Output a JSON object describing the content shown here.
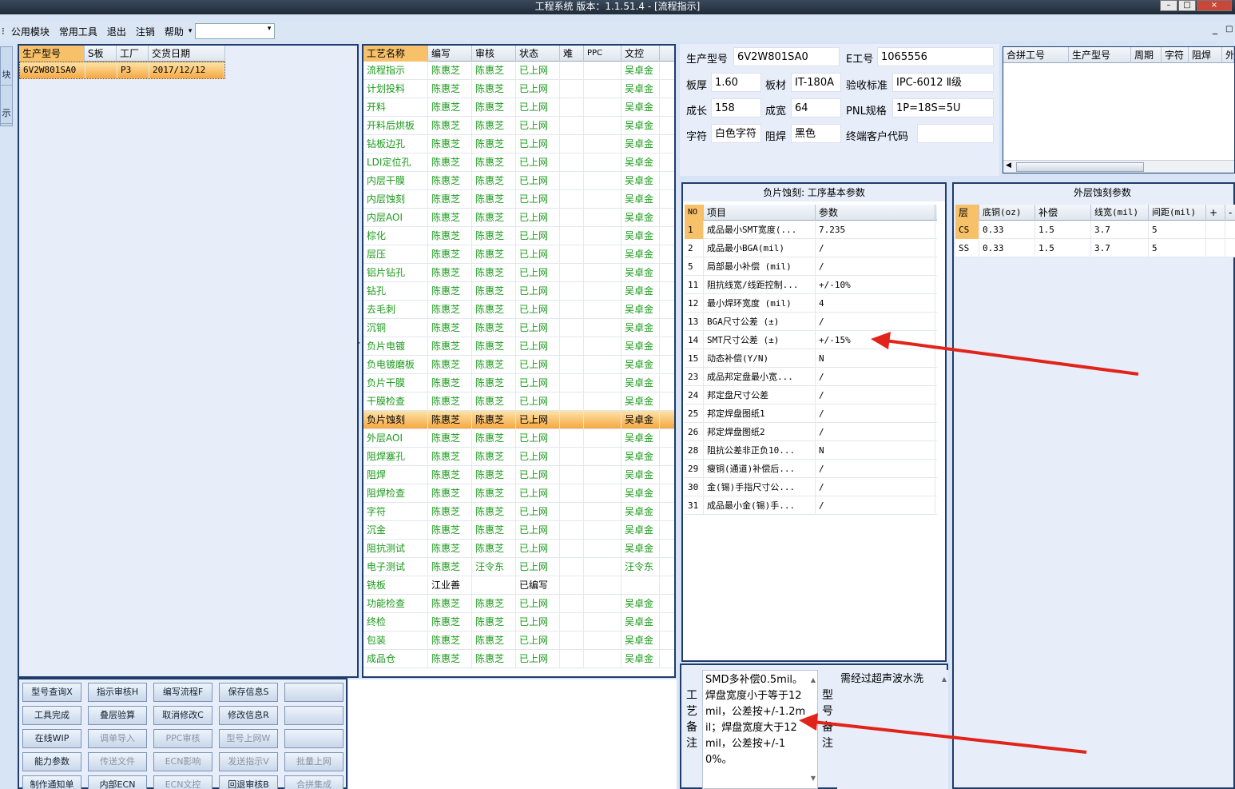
{
  "app": {
    "title": "工程系统  版本：1.1.51.4 - [流程指示]",
    "win_min": "–",
    "win_max": "□",
    "win_close": "×"
  },
  "menu": {
    "items": [
      "公用模块",
      "常用工具",
      "退出",
      "注销",
      "帮助"
    ],
    "helper_arrow": "▾",
    "combo_value": "",
    "left_glyph": "⁝",
    "right_icons": [
      "_",
      "□"
    ]
  },
  "leftstrip": {
    "tabs": [
      "块",
      "示"
    ]
  },
  "orders": {
    "columns": [
      "生产型号",
      "S板",
      "工厂",
      "交货日期"
    ],
    "rows": [
      {
        "model": "6V2W801SA0",
        "s": "",
        "factory": "P3",
        "date": "2017/12/12"
      }
    ]
  },
  "process": {
    "columns": [
      "工艺名称",
      "编写",
      "审核",
      "状态",
      "难",
      "PPC",
      "文控"
    ],
    "rows": [
      [
        "流程指示",
        "陈惠芝",
        "陈惠芝",
        "已上网",
        "",
        "",
        "吴卓金"
      ],
      [
        "计划投料",
        "陈惠芝",
        "陈惠芝",
        "已上网",
        "",
        "",
        "吴卓金"
      ],
      [
        "开料",
        "陈惠芝",
        "陈惠芝",
        "已上网",
        "",
        "",
        "吴卓金"
      ],
      [
        "开料后烘板",
        "陈惠芝",
        "陈惠芝",
        "已上网",
        "",
        "",
        "吴卓金"
      ],
      [
        "钻板边孔",
        "陈惠芝",
        "陈惠芝",
        "已上网",
        "",
        "",
        "吴卓金"
      ],
      [
        "LDI定位孔",
        "陈惠芝",
        "陈惠芝",
        "已上网",
        "",
        "",
        "吴卓金"
      ],
      [
        "内层干膜",
        "陈惠芝",
        "陈惠芝",
        "已上网",
        "",
        "",
        "吴卓金"
      ],
      [
        "内层蚀刻",
        "陈惠芝",
        "陈惠芝",
        "已上网",
        "",
        "",
        "吴卓金"
      ],
      [
        "内层AOI",
        "陈惠芝",
        "陈惠芝",
        "已上网",
        "",
        "",
        "吴卓金"
      ],
      [
        "棕化",
        "陈惠芝",
        "陈惠芝",
        "已上网",
        "",
        "",
        "吴卓金"
      ],
      [
        "层压",
        "陈惠芝",
        "陈惠芝",
        "已上网",
        "",
        "",
        "吴卓金"
      ],
      [
        "铝片钻孔",
        "陈惠芝",
        "陈惠芝",
        "已上网",
        "",
        "",
        "吴卓金"
      ],
      [
        "钻孔",
        "陈惠芝",
        "陈惠芝",
        "已上网",
        "",
        "",
        "吴卓金"
      ],
      [
        "去毛刺",
        "陈惠芝",
        "陈惠芝",
        "已上网",
        "",
        "",
        "吴卓金"
      ],
      [
        "沉铜",
        "陈惠芝",
        "陈惠芝",
        "已上网",
        "",
        "",
        "吴卓金"
      ],
      [
        "负片电镀",
        "陈惠芝",
        "陈惠芝",
        "已上网",
        "",
        "",
        "吴卓金"
      ],
      [
        "负电镀磨板",
        "陈惠芝",
        "陈惠芝",
        "已上网",
        "",
        "",
        "吴卓金"
      ],
      [
        "负片干膜",
        "陈惠芝",
        "陈惠芝",
        "已上网",
        "",
        "",
        "吴卓金"
      ],
      [
        "干膜检查",
        "陈惠芝",
        "陈惠芝",
        "已上网",
        "",
        "",
        "吴卓金"
      ],
      [
        "负片蚀刻",
        "陈惠芝",
        "陈惠芝",
        "已上网",
        "",
        "",
        "吴卓金"
      ],
      [
        "外层AOI",
        "陈惠芝",
        "陈惠芝",
        "已上网",
        "",
        "",
        "吴卓金"
      ],
      [
        "阻焊塞孔",
        "陈惠芝",
        "陈惠芝",
        "已上网",
        "",
        "",
        "吴卓金"
      ],
      [
        "阻焊",
        "陈惠芝",
        "陈惠芝",
        "已上网",
        "",
        "",
        "吴卓金"
      ],
      [
        "阻焊检查",
        "陈惠芝",
        "陈惠芝",
        "已上网",
        "",
        "",
        "吴卓金"
      ],
      [
        "字符",
        "陈惠芝",
        "陈惠芝",
        "已上网",
        "",
        "",
        "吴卓金"
      ],
      [
        "沉金",
        "陈惠芝",
        "陈惠芝",
        "已上网",
        "",
        "",
        "吴卓金"
      ],
      [
        "阻抗测试",
        "陈惠芝",
        "陈惠芝",
        "已上网",
        "",
        "",
        "吴卓金"
      ],
      [
        "电子测试",
        "陈惠芝",
        "汪令东",
        "已上网",
        "",
        "",
        "汪令东"
      ],
      [
        "铣板",
        "江业善",
        "",
        "已编写",
        "",
        "",
        ""
      ],
      [
        "功能检查",
        "陈惠芝",
        "陈惠芝",
        "已上网",
        "",
        "",
        "吴卓金"
      ],
      [
        "终检",
        "陈惠芝",
        "陈惠芝",
        "已上网",
        "",
        "",
        "吴卓金"
      ],
      [
        "包装",
        "陈惠芝",
        "陈惠芝",
        "已上网",
        "",
        "",
        "吴卓金"
      ],
      [
        "成品仓",
        "陈惠芝",
        "陈惠芝",
        "已上网",
        "",
        "",
        "吴卓金"
      ]
    ],
    "selected_index": 19
  },
  "buttons": [
    [
      "型号查询X",
      "指示审核H",
      "编写流程F",
      "保存信息S",
      ""
    ],
    [
      "工具完成",
      "叠层验算",
      "取消修改C",
      "修改信息R",
      ""
    ],
    [
      "在线WIP",
      "调单导入",
      "PPC审核",
      "型号上网W",
      ""
    ],
    [
      "能力参数",
      "传送文件",
      "ECN影响",
      "发送指示V",
      "批量上网"
    ],
    [
      "制作通知单",
      "内部ECN",
      "ECN文控",
      "回退审核B",
      "合拼集成"
    ]
  ],
  "disabled_buttons": [
    "调单导入",
    "PPC审核",
    "型号上网W",
    "传送文件",
    "ECN影响",
    "发送指示V",
    "批量上网",
    "ECN文控",
    "合拼集成"
  ],
  "info": {
    "model_label": "生产型号",
    "model": "6V2W801SA0",
    "e_label": "E工号",
    "e": "1065556",
    "thick_label": "板厚",
    "thick": "1.60",
    "mat_label": "板材",
    "mat": "IT-180A",
    "std_label": "验收标准",
    "std": "IPC-6012 Ⅱ级",
    "len_label": "成长",
    "len": "158",
    "wid_label": "成宽",
    "wid": "64",
    "pnl_label": "PNL规格",
    "pnl": "1P=18S=5U",
    "char_label": "字符",
    "char": "白色字符",
    "mask_label": "阻焊",
    "mask": "黑色",
    "cust_label": "终端客户代码",
    "cust": ""
  },
  "merge": {
    "columns": [
      "合拼工号",
      "生产型号",
      "周期",
      "字符",
      "阻焊",
      "外"
    ]
  },
  "params": {
    "title": "负片蚀刻: 工序基本参数",
    "columns": [
      "NO",
      "项目",
      "参数"
    ],
    "rows": [
      [
        "1",
        "成品最小SMT宽度(...",
        "7.235"
      ],
      [
        "2",
        "成品最小BGA(mil)",
        "/"
      ],
      [
        "5",
        "局部最小补偿 (mil)",
        "/"
      ],
      [
        "11",
        "阻抗线宽/线距控制...",
        "+/-10%"
      ],
      [
        "12",
        "最小焊环宽度 (mil)",
        "4"
      ],
      [
        "13",
        "BGA尺寸公差 (±)",
        "/"
      ],
      [
        "14",
        "SMT尺寸公差 (±)",
        "+/-15%"
      ],
      [
        "15",
        "动态补偿(Y/N)",
        "N"
      ],
      [
        "23",
        "成品邦定盘最小宽...",
        "/"
      ],
      [
        "24",
        "邦定盘尺寸公差",
        "/"
      ],
      [
        "25",
        "邦定焊盘图纸1",
        "/"
      ],
      [
        "26",
        "邦定焊盘图纸2",
        "/"
      ],
      [
        "28",
        "阻抗公差非正负10...",
        "N"
      ],
      [
        "29",
        "瘦铜(通道)补偿后...",
        "/"
      ],
      [
        "30",
        "金(锡)手指尺寸公...",
        "/"
      ],
      [
        "31",
        "成品最小金(锡)手...",
        "/"
      ]
    ]
  },
  "outer": {
    "title": "外层蚀刻参数",
    "columns": [
      "层",
      "底铜(oz)",
      "补偿",
      "线宽(mil)",
      "间距(mil)",
      "+",
      "-"
    ],
    "rows": [
      [
        "CS",
        "0.33",
        "1.5",
        "3.7",
        "5"
      ],
      [
        "SS",
        "0.33",
        "1.5",
        "3.7",
        "5"
      ]
    ]
  },
  "notes": {
    "process_label": [
      "工",
      "艺",
      "备",
      "注"
    ],
    "process_note": "SMD多补偿0.5mil。焊盘宽度小于等于12mil，公差按+/-1.2mil；焊盘宽度大于12mil，公差按+/-10%。",
    "model_label": [
      "型",
      "号",
      "备",
      "注"
    ],
    "model_note": "需经过超声波水洗"
  },
  "scroll": {
    "up": "▲",
    "down": "▼",
    "left": "◀",
    "right": "▶",
    "splitter": "▸"
  },
  "colors": {
    "accent_green": "#1a9a1a",
    "selection": "#f5a742",
    "arrow": "#e2231a",
    "frame": "#1f3c6b"
  }
}
